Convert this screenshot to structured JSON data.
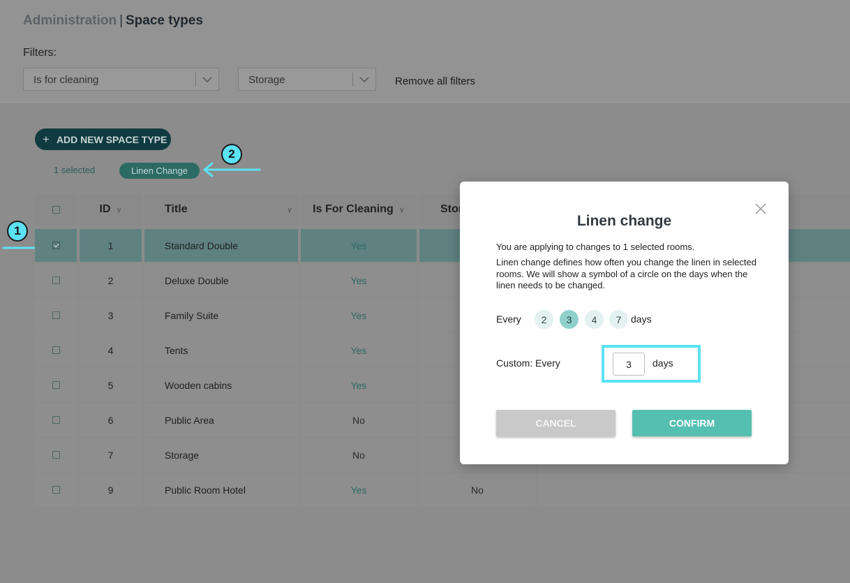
{
  "breadcrumb": {
    "parent": "Administration",
    "separator": "|",
    "current": "Space types"
  },
  "filters": {
    "label": "Filters:",
    "filter1": "Is for cleaning",
    "filter2": "Storage",
    "remove_all": "Remove all filters"
  },
  "add_button": {
    "plus": "+",
    "label": "ADD NEW SPACE TYPE"
  },
  "selection": {
    "count_text": "1 selected",
    "chip": "Linen Change"
  },
  "annotations": {
    "badge1": "1",
    "badge2": "2",
    "color": "#5be2f4"
  },
  "table": {
    "headers": {
      "id": "ID",
      "title": "Title",
      "is_for_cleaning": "Is For Cleaning",
      "storage": "Stor"
    },
    "rows": [
      {
        "id": "1",
        "title": "Standard Double",
        "cleaning": "Yes",
        "storage": "",
        "checked": true
      },
      {
        "id": "2",
        "title": "Deluxe Double",
        "cleaning": "Yes",
        "storage": ""
      },
      {
        "id": "3",
        "title": "Family Suite",
        "cleaning": "Yes",
        "storage": ""
      },
      {
        "id": "4",
        "title": "Tents",
        "cleaning": "Yes",
        "storage": ""
      },
      {
        "id": "5",
        "title": "Wooden cabins",
        "cleaning": "Yes",
        "storage": ""
      },
      {
        "id": "6",
        "title": "Public Area",
        "cleaning": "No",
        "storage": ""
      },
      {
        "id": "7",
        "title": "Storage",
        "cleaning": "No",
        "storage": ""
      },
      {
        "id": "9",
        "title": "Public Room Hotel",
        "cleaning": "Yes",
        "storage": "No"
      }
    ]
  },
  "modal": {
    "title": "Linen change",
    "intro": "You are applying to changes to 1 selected rooms.",
    "description": "Linen change defines how often you change the linen in selected rooms. We will show a symbol of a circle on the days when the linen needs to be changed.",
    "every_label": "Every",
    "options": [
      "2",
      "3",
      "4",
      "7"
    ],
    "selected_option": "3",
    "days_label": "days",
    "custom_label": "Custom: Every",
    "custom_value": "3",
    "custom_days_label": "days",
    "cancel": "CANCEL",
    "confirm": "CONFIRM"
  },
  "colors": {
    "accent": "#55c0b1",
    "dark_button": "#0f3b40",
    "highlight": "#5be2f4"
  }
}
